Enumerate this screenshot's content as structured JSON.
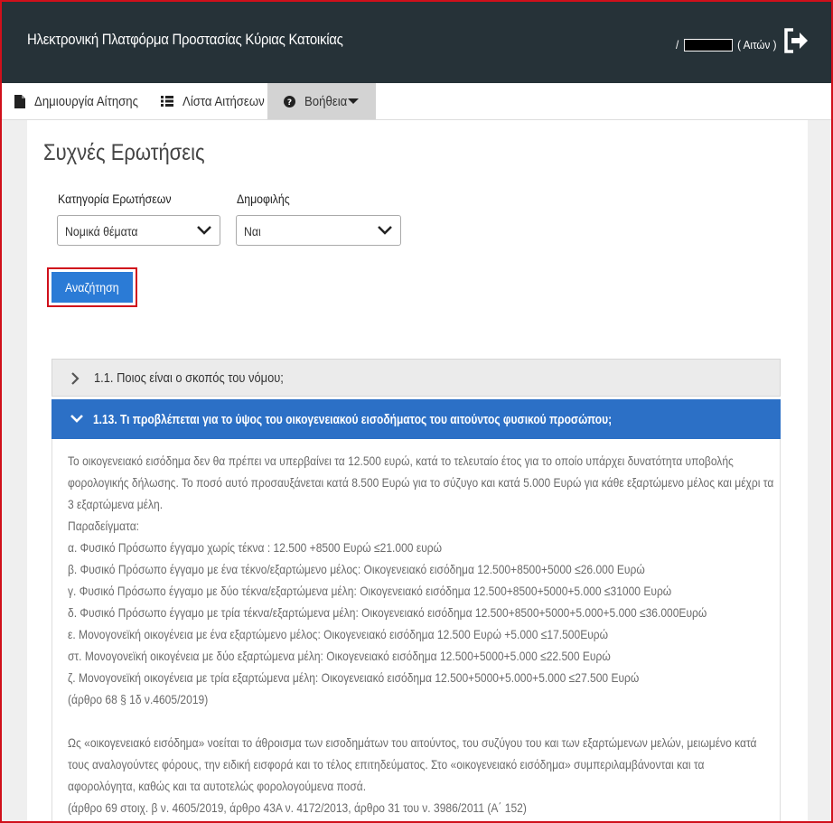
{
  "header": {
    "title": "Ηλεκτρονική Πλατφόρμα Προστασίας Κύριας Κατοικίας",
    "user_prefix": "/",
    "user_role": "( Αιτών )",
    "logout_icon": "logout-icon"
  },
  "tabs": [
    {
      "label": "Δημιουργία Αίτησης",
      "icon": "document-icon"
    },
    {
      "label": "Λίστα Αιτήσεων",
      "icon": "list-icon"
    },
    {
      "label": "Βοήθεια",
      "icon": "question-icon"
    }
  ],
  "page": {
    "title": "Συχνές Ερωτήσεις"
  },
  "filters": {
    "category_label": "Κατηγορία Ερωτήσεων",
    "category_value": "Νομικά θέματα",
    "popular_label": "Δημοφιλής",
    "popular_value": "Ναι",
    "search_button": "Αναζήτηση"
  },
  "faq": {
    "item1_title": "1.1. Ποιος είναι ο σκοπός του νόμου;",
    "item2_title": "1.13. Τι προβλέπεται για το ύψος του οικογενειακού εισοδήματος του αιτούντος φυσικού προσώπου;",
    "lines": [
      "Το οικογενειακό εισόδημα δεν θα πρέπει να υπερβαίνει τα 12.500 ευρώ, κατά το τελευταίο έτος για το οποίο υπάρχει δυνατότητα υποβολής",
      "φορολογικής δήλωσης. Το ποσό αυτό προσαυξάνεται κατά 8.500 Ευρώ για το σύζυγο και κατά 5.000 Ευρώ για κάθε εξαρτώμενο μέλος και μέχρι τα",
      "3 εξαρτώμενα μέλη.",
      "Παραδείγματα:",
      "α. Φυσικό Πρόσωπο έγγαμο χωρίς τέκνα : 12.500 +8500 Ευρώ ≤21.000 ευρώ",
      "β. Φυσικό Πρόσωπο έγγαμο με ένα τέκνο/εξαρτώμενο μέλος: Οικογενειακό εισόδημα 12.500+8500+5000 ≤26.000 Ευρώ",
      "γ. Φυσικό Πρόσωπο έγγαμο με δύο τέκνα/εξαρτώμενα μέλη: Οικογενειακό εισόδημα 12.500+8500+5000+5.000 ≤31000 Ευρώ",
      "δ. Φυσικό Πρόσωπο έγγαμο με τρία τέκνα/εξαρτώμενα μέλη: Οικογενειακό εισόδημα 12.500+8500+5000+5.000+5.000 ≤36.000Ευρώ",
      "ε. Μονογονεϊκή οικογένεια με ένα εξαρτώμενο μέλος: Οικογενειακό εισόδημα 12.500 Ευρώ +5.000 ≤17.500Ευρώ",
      "στ. Μονογονεϊκή οικογένεια με δύο εξαρτώμενα μέλη: Οικογενειακό εισόδημα 12.500+5000+5.000 ≤22.500 Ευρώ",
      "ζ. Μονογονεϊκή οικογένεια με τρία εξαρτώμενα μέλη: Οικογενειακό εισόδημα 12.500+5000+5.000+5.000 ≤27.500 Ευρώ",
      "(άρθρο 68 § 1δ ν.4605/2019)",
      "",
      "Ως «οικογενειακό εισόδημα» νοείται το άθροισμα των εισοδημάτων του αιτούντος, του συζύγου του και των εξαρτώμενων μελών, μειωμένο κατά",
      "τους αναλογούντες φόρους, την ειδική εισφορά και το τέλος επιτηδεύματος. Στο «οικογενειακό εισόδημα» συμπεριλαμβάνονται και τα",
      "αφορολόγητα, καθώς και τα αυτοτελώς φορολογούμενα ποσά.",
      "(άρθρο 69 στοιχ. β ν. 4605/2019, άρθρο 43Α ν. 4172/2013, άρθρο 31 του ν. 3986/2011 (Α΄ 152)"
    ]
  },
  "colors": {
    "topbar": "#263238",
    "accent": "#2b7bd6",
    "highlight": "#d0101b"
  }
}
